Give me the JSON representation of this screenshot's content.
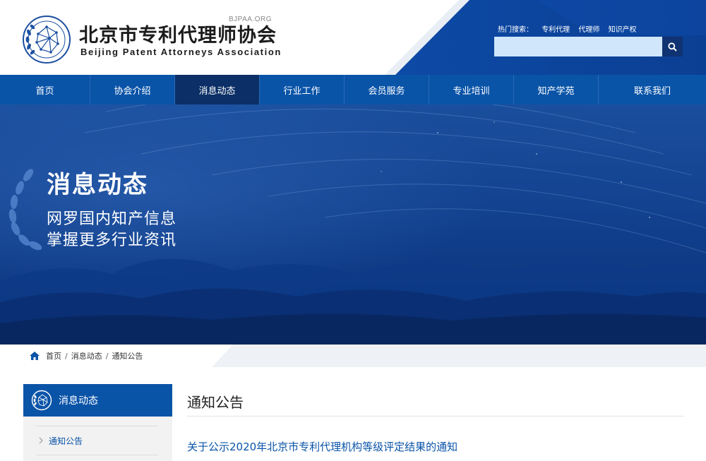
{
  "header": {
    "logo_cn": "北京市专利代理师协会",
    "logo_en": "Beijing Patent Attorneys Association",
    "domain": "BJPAA.ORG",
    "hot_search_label": "热门搜索：",
    "hot_terms": [
      "专利代理",
      "代理师",
      "知识产权"
    ],
    "search_placeholder": "",
    "search_icon": "search-icon"
  },
  "nav": {
    "items": [
      {
        "label": "首页"
      },
      {
        "label": "协会介绍"
      },
      {
        "label": "消息动态"
      },
      {
        "label": "行业工作"
      },
      {
        "label": "会员服务"
      },
      {
        "label": "专业培训"
      },
      {
        "label": "知产学苑"
      },
      {
        "label": "联系我们"
      }
    ],
    "active_index": 2
  },
  "banner": {
    "title": "消息动态",
    "line1": "网罗国内知产信息",
    "line2": "掌握更多行业资讯"
  },
  "breadcrumb": {
    "home_icon": "home-icon",
    "items": [
      "首页",
      "消息动态",
      "通知公告"
    ],
    "separator": "/"
  },
  "sidebar": {
    "title": "消息动态",
    "items": [
      {
        "label": "通知公告"
      }
    ]
  },
  "main": {
    "title": "通知公告",
    "articles": [
      {
        "title": "关于公示2020年北京市专利代理机构等级评定结果的通知"
      }
    ]
  },
  "colors": {
    "primary_blue": "#0a54a8",
    "dark_blue": "#0b2f66",
    "search_bg": "#cfe6fb"
  }
}
